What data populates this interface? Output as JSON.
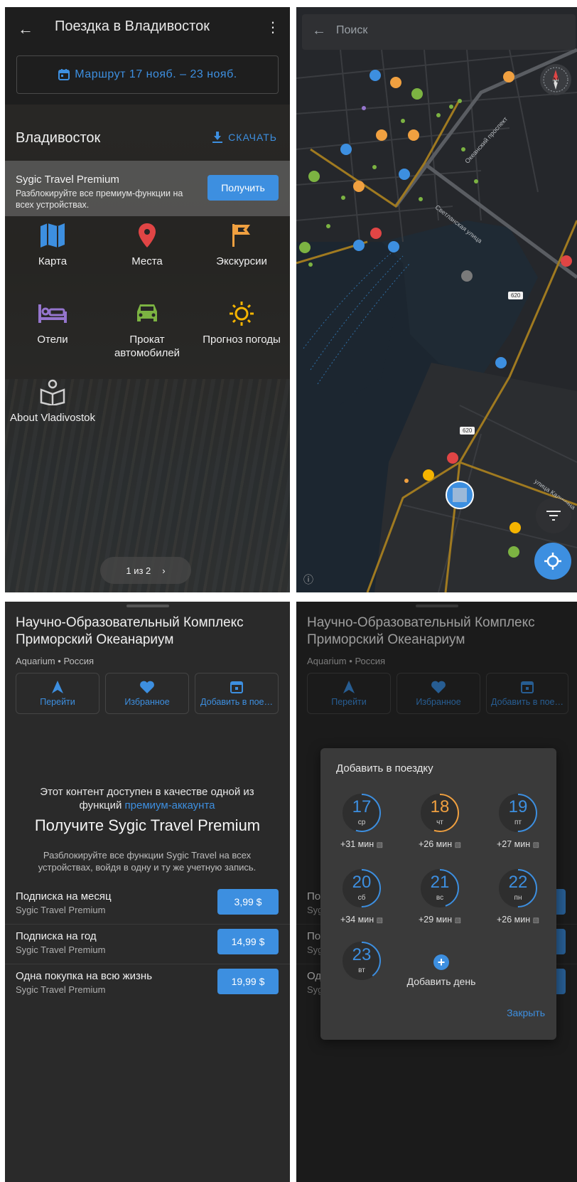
{
  "trip": {
    "title": "Поездка в Владивосток",
    "route_label": "Маршрут 17 нояб. – 23 нояб.",
    "city": "Владивосток",
    "download_label": "СКАЧАТЬ",
    "premium_title": "Sygic Travel Premium",
    "premium_sub": "Разблокируйте все премиум-функции на всех устройствах.",
    "get_label": "Получить",
    "tiles": [
      {
        "label": "Карта"
      },
      {
        "label": "Места"
      },
      {
        "label": "Экскурсии"
      },
      {
        "label": "Отели"
      },
      {
        "label": "Прокат автомобилей"
      },
      {
        "label": "Прогноз погоды"
      },
      {
        "label": "About Vladivostok"
      }
    ],
    "pager": "1 из 2"
  },
  "map": {
    "search_placeholder": "Поиск",
    "labels": [
      "Океанский проспект",
      "Светланская улица",
      "улица Калинина"
    ],
    "shields": [
      "620",
      "620"
    ],
    "compass_letter": "N"
  },
  "poi": {
    "title": "Научно-Образовательный Комплекс Приморский Океанариум",
    "category": "Aquarium",
    "country": "Россия",
    "actions": [
      {
        "label": "Перейти"
      },
      {
        "label": "Избранное"
      },
      {
        "label": "Добавить в пое…"
      }
    ],
    "offer_line1": "Этот контент доступен в качестве одной из",
    "offer_line2_prefix": "функций ",
    "offer_link": "премиум-аккаунта",
    "offer_heading": "Получите Sygic Travel Premium",
    "offer_desc": "Разблокируйте все функции Sygic Travel на всех устройствах, войдя в одну и ту же учетную запись.",
    "subscriptions": [
      {
        "name": "Подписка на месяц",
        "sub": "Sygic Travel Premium",
        "price": "3,99 $"
      },
      {
        "name": "Подписка на год",
        "sub": "Sygic Travel Premium",
        "price": "14,99 $"
      },
      {
        "name": "Одна покупка на всю жизнь",
        "sub": "Sygic Travel Premium",
        "price": "19,99 $"
      }
    ],
    "behind_rows": [
      {
        "n": "По",
        "s": "Syg"
      },
      {
        "n": "По",
        "s": "Syg"
      },
      {
        "n": "Од",
        "s": "Syg"
      }
    ]
  },
  "dialog": {
    "title": "Добавить в поездку",
    "days": [
      {
        "num": "17",
        "wd": "ср",
        "dur": "+31 мин",
        "color": "#3d8fe0",
        "fill": 0.55
      },
      {
        "num": "18",
        "wd": "чт",
        "dur": "+26 мин",
        "color": "#f0a040",
        "fill": 0.55
      },
      {
        "num": "19",
        "wd": "пт",
        "dur": "+27 мин",
        "color": "#3d8fe0",
        "fill": 0.5
      },
      {
        "num": "20",
        "wd": "сб",
        "dur": "+34 мин",
        "color": "#3d8fe0",
        "fill": 0.5
      },
      {
        "num": "21",
        "wd": "вс",
        "dur": "+29 мин",
        "color": "#3d8fe0",
        "fill": 0.45
      },
      {
        "num": "22",
        "wd": "пн",
        "dur": "+26 мин",
        "color": "#3d8fe0",
        "fill": 0.5
      },
      {
        "num": "23",
        "wd": "вт",
        "dur": "",
        "color": "#3d8fe0",
        "fill": 0.4
      }
    ],
    "add_day": "Добавить день",
    "close": "Закрыть"
  },
  "colors": {
    "accent": "#3d8fe0",
    "orange": "#f0a040",
    "red_pin": "#e04545",
    "green": "#7cb342",
    "purple": "#9575cd",
    "yellow": "#f5b400"
  }
}
